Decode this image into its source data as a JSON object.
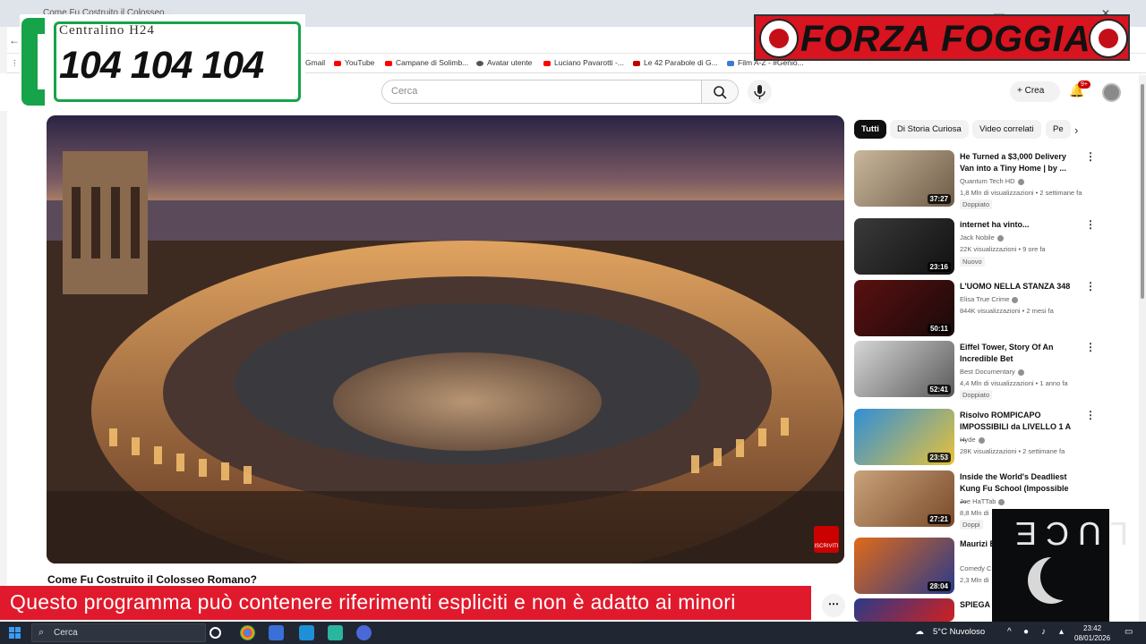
{
  "browser": {
    "tab_title": "Come Fu Costruito il Colosseo...",
    "bookmarks": [
      {
        "label": "Gmail",
        "color": "#ea4335"
      },
      {
        "label": "YouTube",
        "color": "#ff0000"
      },
      {
        "label": "Campane di Solimb...",
        "color": "#ff0000"
      },
      {
        "label": "Avatar utente",
        "color": "#555555"
      },
      {
        "label": "Luciano Pavarotti -...",
        "color": "#ff0000"
      },
      {
        "label": "Le 42 Parabole di G...",
        "color": "#c00000"
      },
      {
        "label": "Film A-Z - #Genio...",
        "color": "#3a7bd5"
      }
    ]
  },
  "youtube": {
    "search_placeholder": "Cerca",
    "create_label": "Crea",
    "notifications": "9+",
    "video_title": "Come Fu Costruito il Colosseo Romano?",
    "iscriviti_label": "ISCRIVITI",
    "chips": [
      "Tutti",
      "Di Storia Curiosa",
      "Video correlati",
      "Pe"
    ],
    "recommendations": [
      {
        "title": "He Turned a $3,000 Delivery Van into a Tiny Home | by ...",
        "channel": "Quantum Tech HD",
        "meta": "1,8 Mln di visualizzazioni • 2 settimane fa",
        "badge": "Doppiato",
        "duration": "37:27"
      },
      {
        "title": "internet ha vinto...",
        "channel": "Jack Nobile",
        "meta": "22K visualizzazioni • 9 ore fa",
        "badge": "Nuovo",
        "duration": "23:16"
      },
      {
        "title": "L'UOMO NELLA STANZA 348",
        "channel": "Elisa True Crime",
        "meta": "844K visualizzazioni • 2 mesi fa",
        "badge": "",
        "duration": "50:11"
      },
      {
        "title": "Eiffel Tower, Story Of An Incredible Bet",
        "channel": "Best Documentary",
        "meta": "4,4 Mln di visualizzazioni • 1 anno fa",
        "badge": "Doppiato",
        "duration": "52:41"
      },
      {
        "title": "Risolvo ROMPICAPO IMPOSSIBILI da LIVELLO 1 A ...",
        "channel": "Hyde",
        "meta": "28K visualizzazioni • 2 settimane fa",
        "badge": "",
        "duration": "23:53"
      },
      {
        "title": "Inside the World's Deadliest Kung Fu School (Impossible ...",
        "channel": "Joe HaTTab",
        "meta": "8,8 Mln di",
        "badge": "Doppi",
        "duration": "27:21"
      },
      {
        "title": "Maurizi Battisto",
        "channel": "Comedy C",
        "meta": "2,3 Mln di",
        "badge": "",
        "duration": "28:04"
      },
      {
        "title": "SPIEGA MAGIE",
        "channel": "",
        "meta": "",
        "badge": "",
        "duration": ""
      }
    ]
  },
  "overlays": {
    "centralino_label": "Centralino H24",
    "centralino_number": "104 104 104",
    "forza_text": "FORZA FOGGIA",
    "warning_text": "Questo programma  può contenere riferimenti espliciti e non è adatto ai minori",
    "luce_text": "LUCE"
  },
  "taskbar": {
    "search_placeholder": "Cerca",
    "weather": "5°C  Nuvoloso",
    "time": "23:42",
    "date": "08/01/2026"
  }
}
